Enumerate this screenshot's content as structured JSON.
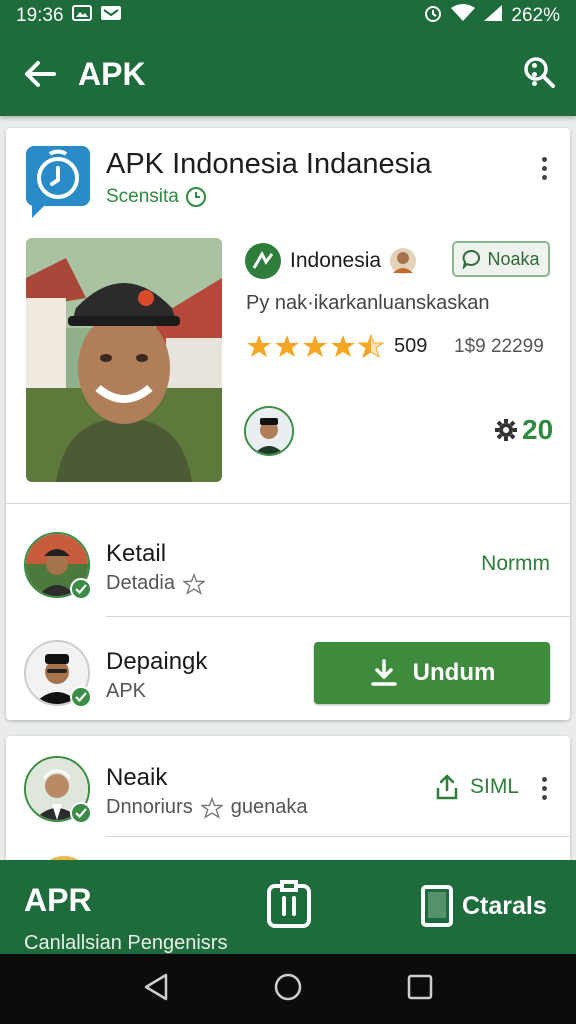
{
  "status_bar": {
    "time": "19:36",
    "battery": "262%"
  },
  "app_bar": {
    "title": "APK"
  },
  "app_card": {
    "title": "APK Indonesia Indanesia",
    "subtitle": "Scensita",
    "developer": "Indonesia",
    "chip_label": "Noaka",
    "description": "Py nak·ikarkanluanskaskan",
    "rating": 4.5,
    "rating_count": "509",
    "downloads": "1$9 22299",
    "badge_number": "20"
  },
  "rows": [
    {
      "title": "Ketail",
      "subtitle": "Detadia",
      "action": "Normm"
    },
    {
      "title": "Depaingk",
      "subtitle": "APK",
      "action": "Undum"
    }
  ],
  "second_card": {
    "title": "Neaik",
    "subtitle_a": "Dnnoriurs",
    "subtitle_b": "guenaka",
    "action": "SIML"
  },
  "bottom_bar": {
    "title": "APR",
    "subtitle": "Canlallsian Pengenisrs",
    "right_label": "Ctarals"
  },
  "colors": {
    "primary": "#1e6b3c",
    "accent": "#3f8b3d",
    "star": "#f5a623"
  },
  "icons": [
    "back-arrow-icon",
    "search-icon",
    "more-vert-icon",
    "clock-icon",
    "download-icon",
    "share-icon",
    "gear-icon",
    "clipboard-icon",
    "tablet-icon"
  ]
}
